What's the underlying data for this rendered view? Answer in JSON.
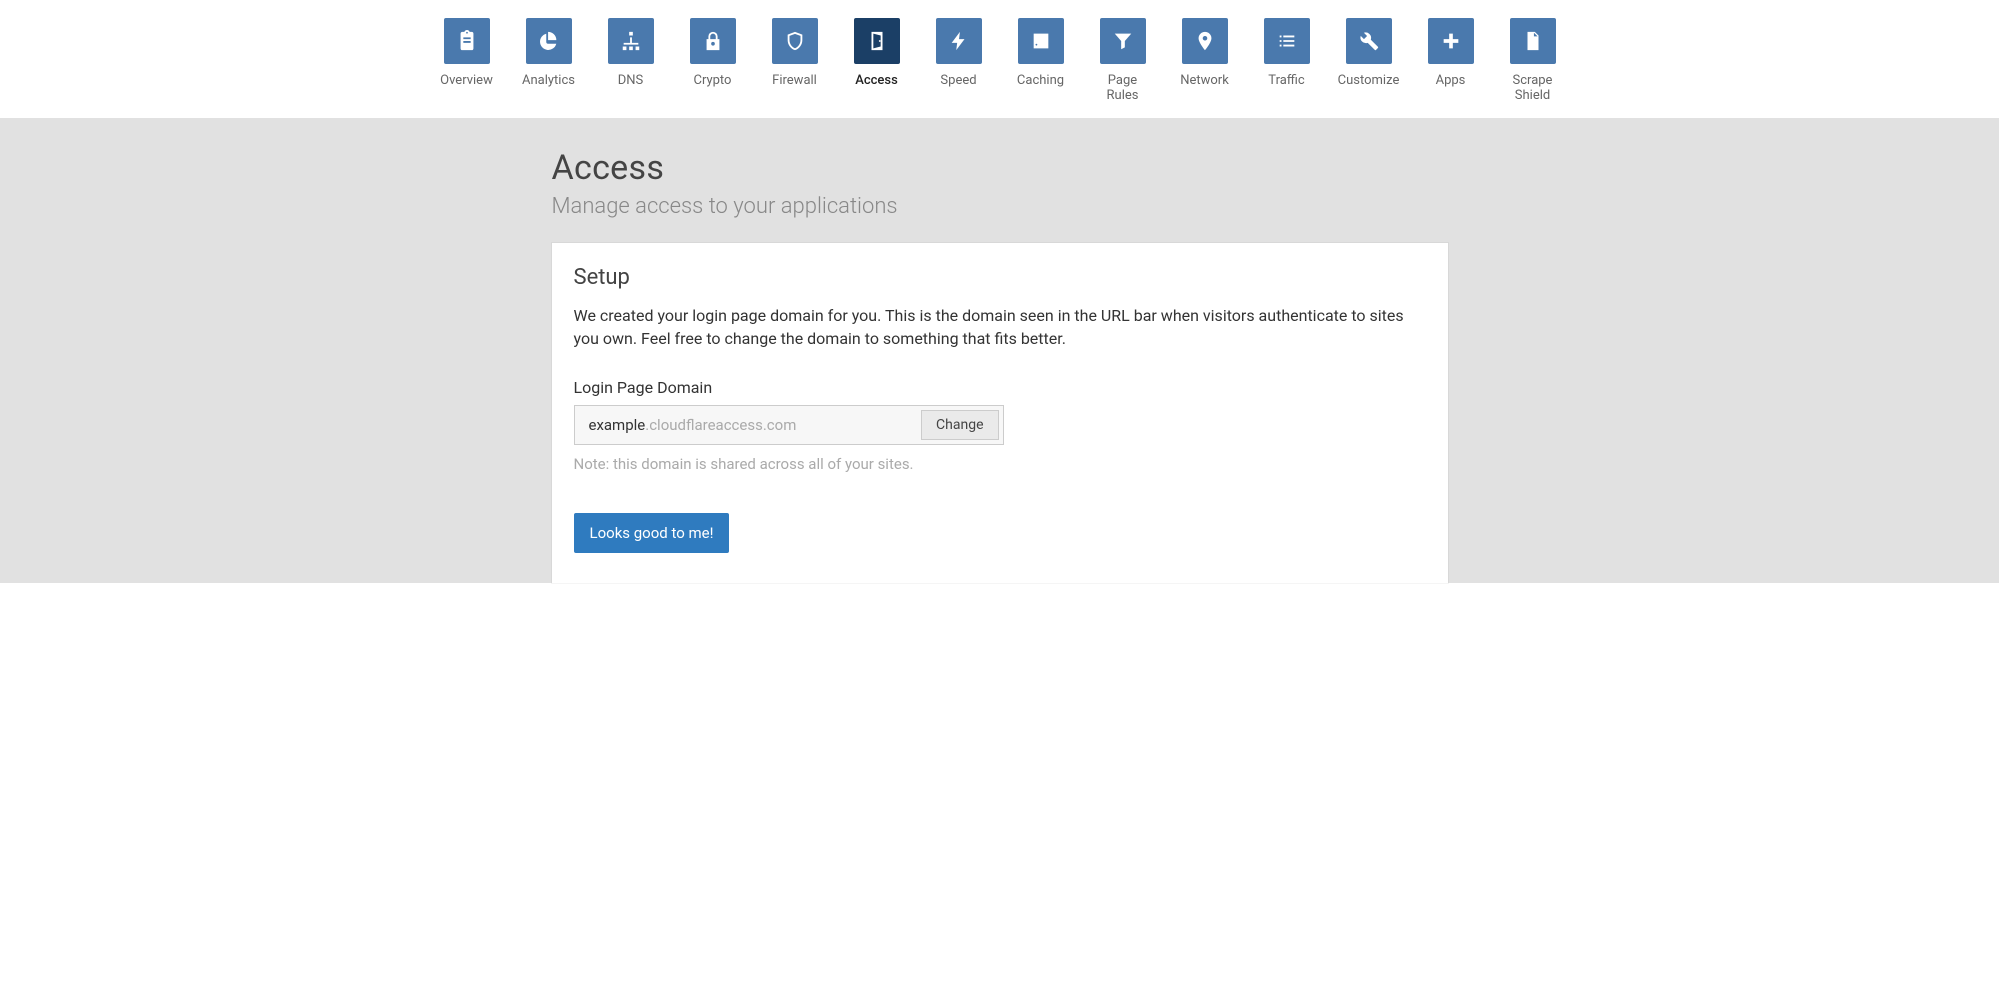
{
  "nav": {
    "items": [
      {
        "id": "overview",
        "label": "Overview"
      },
      {
        "id": "analytics",
        "label": "Analytics"
      },
      {
        "id": "dns",
        "label": "DNS"
      },
      {
        "id": "crypto",
        "label": "Crypto"
      },
      {
        "id": "firewall",
        "label": "Firewall"
      },
      {
        "id": "access",
        "label": "Access",
        "active": true
      },
      {
        "id": "speed",
        "label": "Speed"
      },
      {
        "id": "caching",
        "label": "Caching"
      },
      {
        "id": "page-rules",
        "label": "Page Rules"
      },
      {
        "id": "network",
        "label": "Network"
      },
      {
        "id": "traffic",
        "label": "Traffic"
      },
      {
        "id": "customize",
        "label": "Customize"
      },
      {
        "id": "apps",
        "label": "Apps"
      },
      {
        "id": "scrape-shield",
        "label": "Scrape Shield"
      }
    ]
  },
  "page": {
    "title": "Access",
    "subtitle": "Manage access to your applications"
  },
  "card": {
    "title": "Setup",
    "description": "We created your login page domain for you. This is the domain seen in the URL bar when visitors authenticate to sites you own. Feel free to change the domain to something that fits better.",
    "field_label": "Login Page Domain",
    "domain_value": "example",
    "domain_suffix": ".cloudflareaccess.com",
    "change_label": "Change",
    "note": "Note: this domain is shared across all of your sites.",
    "confirm_label": "Looks good to me!"
  }
}
